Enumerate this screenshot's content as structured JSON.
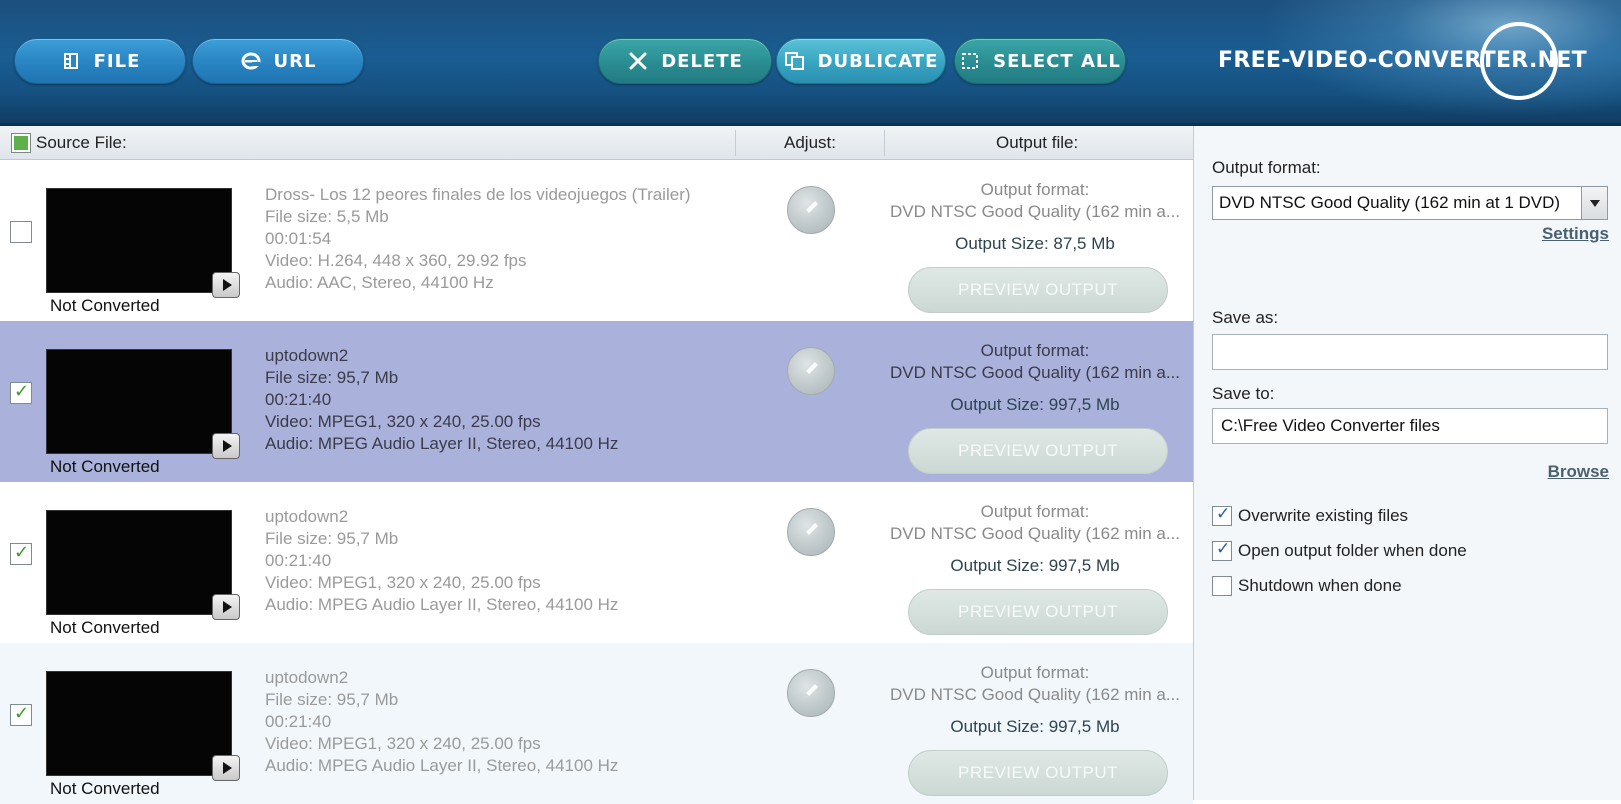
{
  "toolbar": {
    "file_label": "FILE",
    "url_label": "URL",
    "delete_label": "DELETE",
    "duplicate_label": "DUBLICATE",
    "select_all_label": "SELECT ALL",
    "logo_text": "FREE-VIDEO-CONVERTER.NET"
  },
  "columns": {
    "source": "Source File:",
    "adjust": "Adjust:",
    "output": "Output file:"
  },
  "files": [
    {
      "checked": false,
      "selected": false,
      "name": "Dross- Los 12 peores finales de los videojuegos (Trailer)",
      "size": "File size: 5,5 Mb",
      "duration": "00:01:54",
      "video": "Video: H.264, 448 x 360, 29.92 fps",
      "audio": "Audio: AAC, Stereo, 44100 Hz",
      "status": "Not Converted",
      "output_format_label": "Output format:",
      "output_format": "DVD NTSC Good Quality (162 min a...",
      "output_size": "Output Size: 87,5 Mb",
      "preview_label": "PREVIEW OUTPUT"
    },
    {
      "checked": true,
      "selected": true,
      "name": "uptodown2",
      "size": "File size: 95,7 Mb",
      "duration": "00:21:40",
      "video": "Video: MPEG1, 320 x 240, 25.00 fps",
      "audio": "Audio: MPEG Audio Layer II, Stereo, 44100 Hz",
      "status": "Not Converted",
      "output_format_label": "Output format:",
      "output_format": "DVD NTSC Good Quality (162 min a...",
      "output_size": "Output Size: 997,5 Mb",
      "preview_label": "PREVIEW OUTPUT"
    },
    {
      "checked": true,
      "selected": false,
      "name": "uptodown2",
      "size": "File size: 95,7 Mb",
      "duration": "00:21:40",
      "video": "Video: MPEG1, 320 x 240, 25.00 fps",
      "audio": "Audio: MPEG Audio Layer II, Stereo, 44100 Hz",
      "status": "Not Converted",
      "output_format_label": "Output format:",
      "output_format": "DVD NTSC Good Quality (162 min a...",
      "output_size": "Output Size: 997,5 Mb",
      "preview_label": "PREVIEW OUTPUT"
    },
    {
      "checked": true,
      "selected": false,
      "name": "uptodown2",
      "size": "File size: 95,7 Mb",
      "duration": "00:21:40",
      "video": "Video: MPEG1, 320 x 240, 25.00 fps",
      "audio": "Audio: MPEG Audio Layer II, Stereo, 44100 Hz",
      "status": "Not Converted",
      "output_format_label": "Output format:",
      "output_format": "DVD NTSC Good Quality (162 min a...",
      "output_size": "Output Size: 997,5 Mb",
      "preview_label": "PREVIEW OUTPUT"
    }
  ],
  "panel": {
    "output_format_label": "Output format:",
    "output_format_value": "DVD NTSC Good Quality (162 min at 1 DVD)",
    "settings_link": "Settings",
    "save_as_label": "Save as:",
    "save_as_value": "",
    "save_to_label": "Save to:",
    "save_to_value": "C:\\Free Video Converter files",
    "browse_link": "Browse",
    "options": [
      {
        "label": "Overwrite existing files",
        "checked": true
      },
      {
        "label": "Open output folder when done",
        "checked": true
      },
      {
        "label": "Shutdown when done",
        "checked": false
      }
    ]
  },
  "colors": {
    "toolbar_bg": "#1a5d92",
    "selected_row": "#aab1db",
    "check_green": "#3a9a2c"
  }
}
